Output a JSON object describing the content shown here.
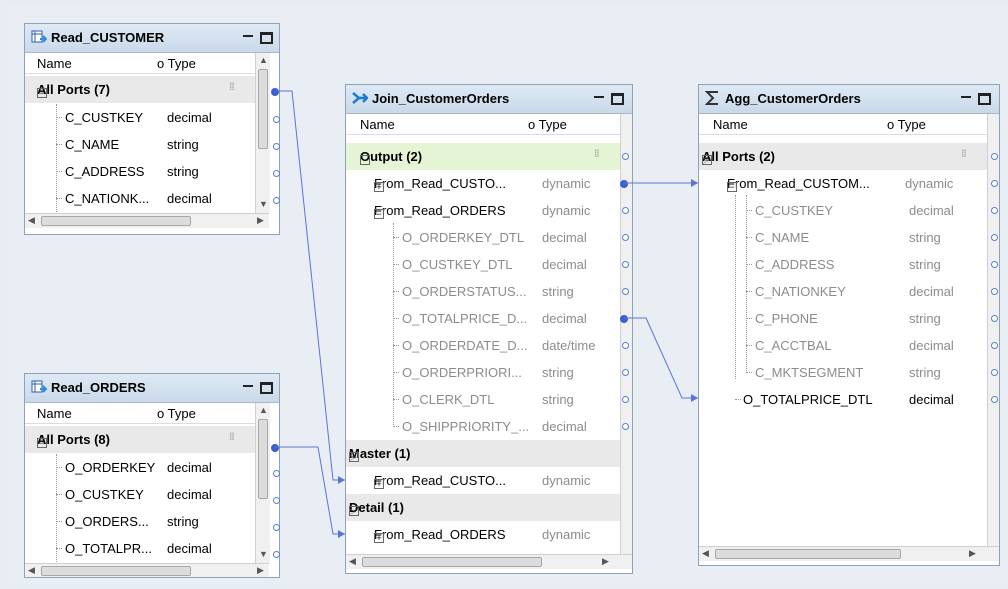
{
  "read_customer": {
    "title": "Read_CUSTOMER",
    "col_name": "Name",
    "col_type": "Type",
    "group": "All Ports (7)",
    "rows": [
      {
        "name": "C_CUSTKEY",
        "type": "decimal"
      },
      {
        "name": "C_NAME",
        "type": "string"
      },
      {
        "name": "C_ADDRESS",
        "type": "string"
      },
      {
        "name": "C_NATIONK...",
        "type": "decimal"
      }
    ]
  },
  "read_orders": {
    "title": "Read_ORDERS",
    "col_name": "Name",
    "col_type": "Type",
    "group": "All Ports (8)",
    "rows": [
      {
        "name": "O_ORDERKEY",
        "type": "decimal"
      },
      {
        "name": "O_CUSTKEY",
        "type": "decimal"
      },
      {
        "name": "O_ORDERS...",
        "type": "string"
      },
      {
        "name": "O_TOTALPR...",
        "type": "decimal"
      }
    ]
  },
  "join": {
    "title": "Join_CustomerOrders",
    "col_name": "Name",
    "col_type": "Type",
    "output_group": "Output (2)",
    "out_rows": [
      {
        "name": "From_Read_CUSTO...",
        "type": "dynamic"
      },
      {
        "name": "From_Read_ORDERS",
        "type": "dynamic"
      }
    ],
    "sub_rows": [
      {
        "name": "O_ORDERKEY_DTL",
        "type": "decimal"
      },
      {
        "name": "O_CUSTKEY_DTL",
        "type": "decimal"
      },
      {
        "name": "O_ORDERSTATUS...",
        "type": "string"
      },
      {
        "name": "O_TOTALPRICE_D...",
        "type": "decimal"
      },
      {
        "name": "O_ORDERDATE_D...",
        "type": "date/time"
      },
      {
        "name": "O_ORDERPRIORI...",
        "type": "string"
      },
      {
        "name": "O_CLERK_DTL",
        "type": "string"
      },
      {
        "name": "O_SHIPPRIORITY_...",
        "type": "decimal"
      }
    ],
    "master_group": "Master (1)",
    "master_row": {
      "name": "From_Read_CUSTO...",
      "type": "dynamic"
    },
    "detail_group": "Detail (1)",
    "detail_row": {
      "name": "From_Read_ORDERS",
      "type": "dynamic"
    }
  },
  "agg": {
    "title": "Agg_CustomerOrders",
    "col_name": "Name",
    "col_type": "Type",
    "group": "All Ports (2)",
    "parent_row": {
      "name": "From_Read_CUSTOM...",
      "type": "dynamic"
    },
    "sub_rows": [
      {
        "name": "C_CUSTKEY",
        "type": "decimal"
      },
      {
        "name": "C_NAME",
        "type": "string"
      },
      {
        "name": "C_ADDRESS",
        "type": "string"
      },
      {
        "name": "C_NATIONKEY",
        "type": "decimal"
      },
      {
        "name": "C_PHONE",
        "type": "string"
      },
      {
        "name": "C_ACCTBAL",
        "type": "decimal"
      },
      {
        "name": "C_MKTSEGMENT",
        "type": "string"
      }
    ],
    "last_row": {
      "name": "O_TOTALPRICE_DTL",
      "type": "decimal"
    }
  },
  "colors": {
    "link": "#5b74d8",
    "output_group_bg": "#e6f4d6",
    "group_bg": "#e9e9e9"
  },
  "icons": [
    "read-source-icon",
    "joiner-icon",
    "aggregator-icon"
  ]
}
